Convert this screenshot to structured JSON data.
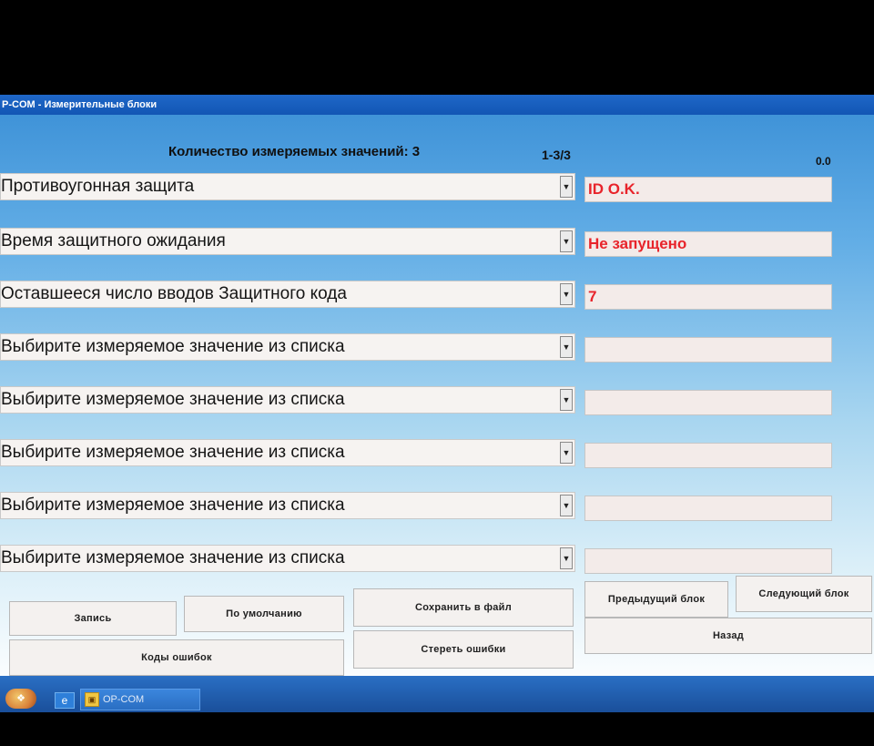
{
  "window": {
    "title": "P-COM - Измерительные блоки"
  },
  "header": {
    "count_label": "Количество измеряемых значений: 3",
    "page_indicator": "1-3/3",
    "time_indicator": "0.0"
  },
  "rows": [
    {
      "label": "Противоугонная защита",
      "value": "ID O.K."
    },
    {
      "label": "Время защитного ожидания",
      "value": "Не запущено"
    },
    {
      "label": "Оставшееся число вводов Защитного кода",
      "value": "7"
    },
    {
      "label": "Выбирите измеряемое значение из списка",
      "value": ""
    },
    {
      "label": "Выбирите измеряемое значение из списка",
      "value": ""
    },
    {
      "label": "Выбирите измеряемое значение из списка",
      "value": ""
    },
    {
      "label": "Выбирите измеряемое значение из списка",
      "value": ""
    },
    {
      "label": "Выбирите измеряемое значение из списка",
      "value": ""
    }
  ],
  "buttons": {
    "record": "Запись",
    "default": "По умолчанию",
    "save_to_file": "Сохранить в файл",
    "prev_block": "Предыдущий блок",
    "next_block": "Следующий блок",
    "error_codes": "Коды ошибок",
    "clear_errors": "Стереть ошибки",
    "back": "Назад"
  },
  "taskbar": {
    "app_label": "OP-COM"
  },
  "icons": {
    "dropdown": "chevron-down-icon",
    "start": "start-orb-icon",
    "browser": "browser-icon",
    "app": "app-icon"
  }
}
